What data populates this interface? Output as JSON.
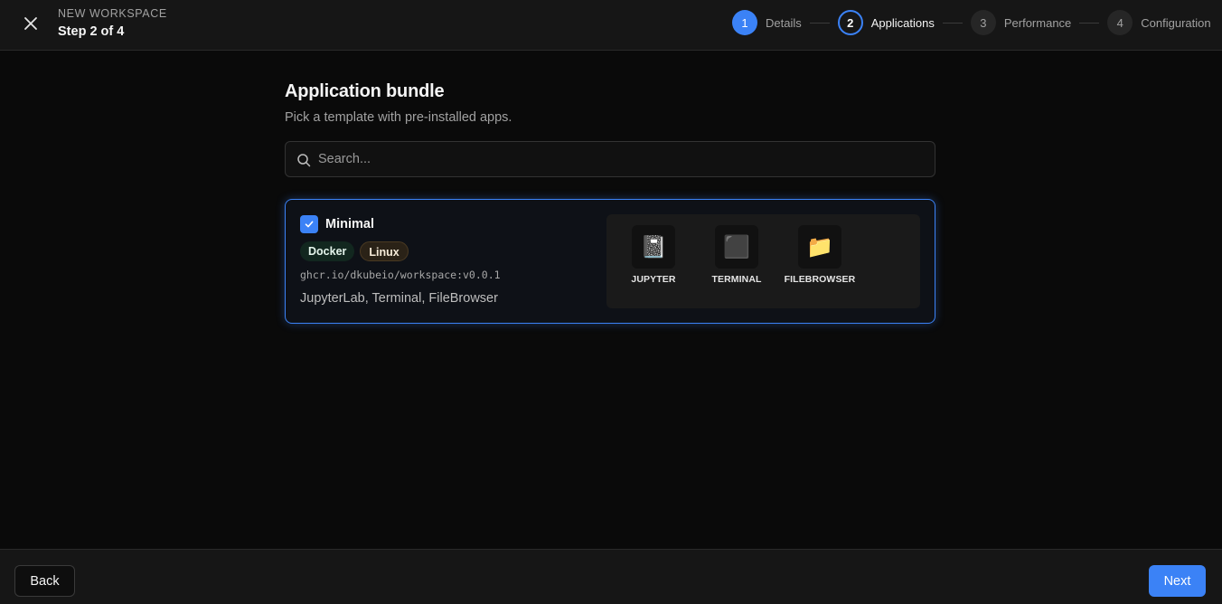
{
  "header": {
    "close_icon": "close-icon",
    "kicker": "NEW WORKSPACE",
    "step_text": "Step 2 of 4"
  },
  "stepper": {
    "steps": [
      {
        "number": "1",
        "label": "Details",
        "state": "done"
      },
      {
        "number": "2",
        "label": "Applications",
        "state": "current"
      },
      {
        "number": "3",
        "label": "Performance",
        "state": "upcoming"
      },
      {
        "number": "4",
        "label": "Configuration",
        "state": "upcoming"
      }
    ]
  },
  "main": {
    "title": "Application bundle",
    "subtitle": "Pick a template with pre-installed apps.",
    "search": {
      "placeholder": "Search...",
      "value": "",
      "icon": "search-icon"
    }
  },
  "bundles": [
    {
      "name": "Minimal",
      "selected": true,
      "badges": [
        "Docker",
        "Linux"
      ],
      "image": "ghcr.io/dkubeio/workspace:v0.0.1",
      "apps_summary": "JupyterLab, Terminal, FileBrowser",
      "apps": [
        {
          "label": "JUPYTER",
          "icon": "📓"
        },
        {
          "label": "TERMINAL",
          "icon": "⬛"
        },
        {
          "label": "FILEBROWSER",
          "icon": "📁"
        }
      ]
    }
  ],
  "footer": {
    "back_label": "Back",
    "next_label": "Next"
  },
  "colors": {
    "accent": "#3b82f6",
    "background": "#0a0a0a",
    "surface": "#161616"
  }
}
